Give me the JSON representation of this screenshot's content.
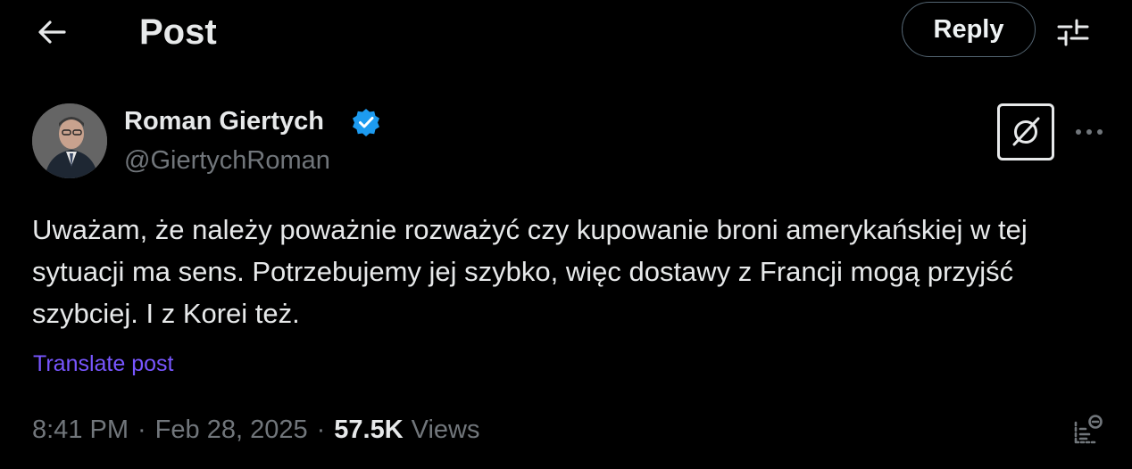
{
  "header": {
    "back_icon": "arrow-left-icon",
    "title": "Post",
    "reply_label": "Reply",
    "adjust_icon": "adjustments-icon"
  },
  "author": {
    "name": "Roman Giertych",
    "handle": "@GiertychRoman",
    "verified": true,
    "verified_color": "#1d9bf0",
    "avatar_icon": "profile-photo"
  },
  "actions": {
    "grok_icon": "grok-icon",
    "more_icon": "more-horizontal-icon"
  },
  "post": {
    "text": "Uważam, że należy poważnie rozważyć czy kupowanie broni amerykańskiej w tej sytuacji ma sens. Potrzebujemy jej szybko, więc dostawy z Francji mogą przyjść szybciej. I z Korei też.",
    "translate_label": "Translate post",
    "translate_color": "#7856ff"
  },
  "meta": {
    "time": "8:41 PM",
    "separator": "·",
    "date": "Feb 28, 2025",
    "views_count": "57.5K",
    "views_label": "Views",
    "analytics_icon": "analytics-icon"
  },
  "theme": {
    "background": "#000000",
    "text_primary": "#e7e9ea",
    "text_secondary": "#71767b",
    "border": "#536471"
  }
}
